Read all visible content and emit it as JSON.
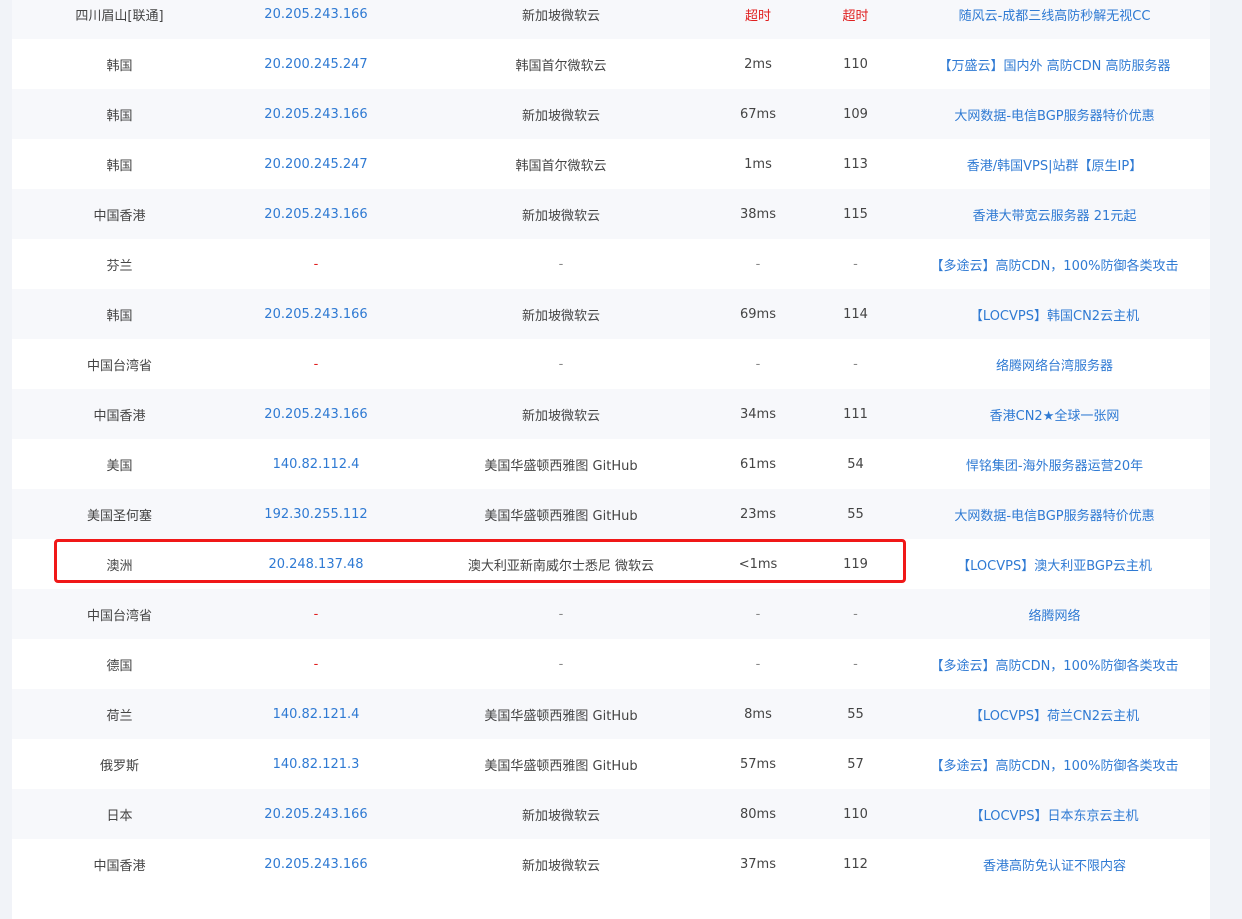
{
  "rows": [
    {
      "location": "四川眉山[联通]",
      "ip": "20.205.243.166",
      "isp": "新加坡微软云",
      "time1": "超时",
      "time2": "超时",
      "ad": "随风云-成都三线高防秒解无视CC",
      "status": "timeout"
    },
    {
      "location": "韩国",
      "ip": "20.200.245.247",
      "isp": "韩国首尔微软云",
      "time1": "2ms",
      "time2": "110",
      "ad": "【万盛云】国内外 高防CDN 高防服务器",
      "status": "ok"
    },
    {
      "location": "韩国",
      "ip": "20.205.243.166",
      "isp": "新加坡微软云",
      "time1": "67ms",
      "time2": "109",
      "ad": "大网数据-电信BGP服务器特价优惠",
      "status": "ok"
    },
    {
      "location": "韩国",
      "ip": "20.200.245.247",
      "isp": "韩国首尔微软云",
      "time1": "1ms",
      "time2": "113",
      "ad": "香港/韩国VPS|站群【原生IP】",
      "status": "ok"
    },
    {
      "location": "中国香港",
      "ip": "20.205.243.166",
      "isp": "新加坡微软云",
      "time1": "38ms",
      "time2": "115",
      "ad": "香港大带宽云服务器 21元起",
      "status": "ok"
    },
    {
      "location": "芬兰",
      "ip": "-",
      "isp": "-",
      "time1": "-",
      "time2": "-",
      "ad": "【多途云】高防CDN，100%防御各类攻击",
      "status": "none"
    },
    {
      "location": "韩国",
      "ip": "20.205.243.166",
      "isp": "新加坡微软云",
      "time1": "69ms",
      "time2": "114",
      "ad": "【LOCVPS】韩国CN2云主机",
      "status": "ok"
    },
    {
      "location": "中国台湾省",
      "ip": "-",
      "isp": "-",
      "time1": "-",
      "time2": "-",
      "ad": "络腾网络台湾服务器",
      "status": "none"
    },
    {
      "location": "中国香港",
      "ip": "20.205.243.166",
      "isp": "新加坡微软云",
      "time1": "34ms",
      "time2": "111",
      "ad": "香港CN2★全球一张网",
      "status": "ok"
    },
    {
      "location": "美国",
      "ip": "140.82.112.4",
      "isp": "美国华盛顿西雅图 GitHub",
      "time1": "61ms",
      "time2": "54",
      "ad": "悍铭集团-海外服务器运营20年",
      "status": "ok"
    },
    {
      "location": "美国圣何塞",
      "ip": "192.30.255.112",
      "isp": "美国华盛顿西雅图 GitHub",
      "time1": "23ms",
      "time2": "55",
      "ad": "大网数据-电信BGP服务器特价优惠",
      "status": "ok"
    },
    {
      "location": "澳洲",
      "ip": "20.248.137.48",
      "isp": "澳大利亚新南威尔士悉尼 微软云",
      "time1": "<1ms",
      "time2": "119",
      "ad": "【LOCVPS】澳大利亚BGP云主机",
      "status": "ok"
    },
    {
      "location": "中国台湾省",
      "ip": "-",
      "isp": "-",
      "time1": "-",
      "time2": "-",
      "ad": "络腾网络",
      "status": "none"
    },
    {
      "location": "德国",
      "ip": "-",
      "isp": "-",
      "time1": "-",
      "time2": "-",
      "ad": "【多途云】高防CDN，100%防御各类攻击",
      "status": "none"
    },
    {
      "location": "荷兰",
      "ip": "140.82.121.4",
      "isp": "美国华盛顿西雅图 GitHub",
      "time1": "8ms",
      "time2": "55",
      "ad": "【LOCVPS】荷兰CN2云主机",
      "status": "ok"
    },
    {
      "location": "俄罗斯",
      "ip": "140.82.121.3",
      "isp": "美国华盛顿西雅图 GitHub",
      "time1": "57ms",
      "time2": "57",
      "ad": "【多途云】高防CDN，100%防御各类攻击",
      "status": "ok"
    },
    {
      "location": "日本",
      "ip": "20.205.243.166",
      "isp": "新加坡微软云",
      "time1": "80ms",
      "time2": "110",
      "ad": "【LOCVPS】日本东京云主机",
      "status": "ok"
    },
    {
      "location": "中国香港",
      "ip": "20.205.243.166",
      "isp": "新加坡微软云",
      "time1": "37ms",
      "time2": "112",
      "ad": "香港高防免认证不限内容",
      "status": "ok"
    }
  ],
  "colors": {
    "link": "#2f7ad3",
    "timeout": "#e02020",
    "highlight_border": "#f01818"
  }
}
